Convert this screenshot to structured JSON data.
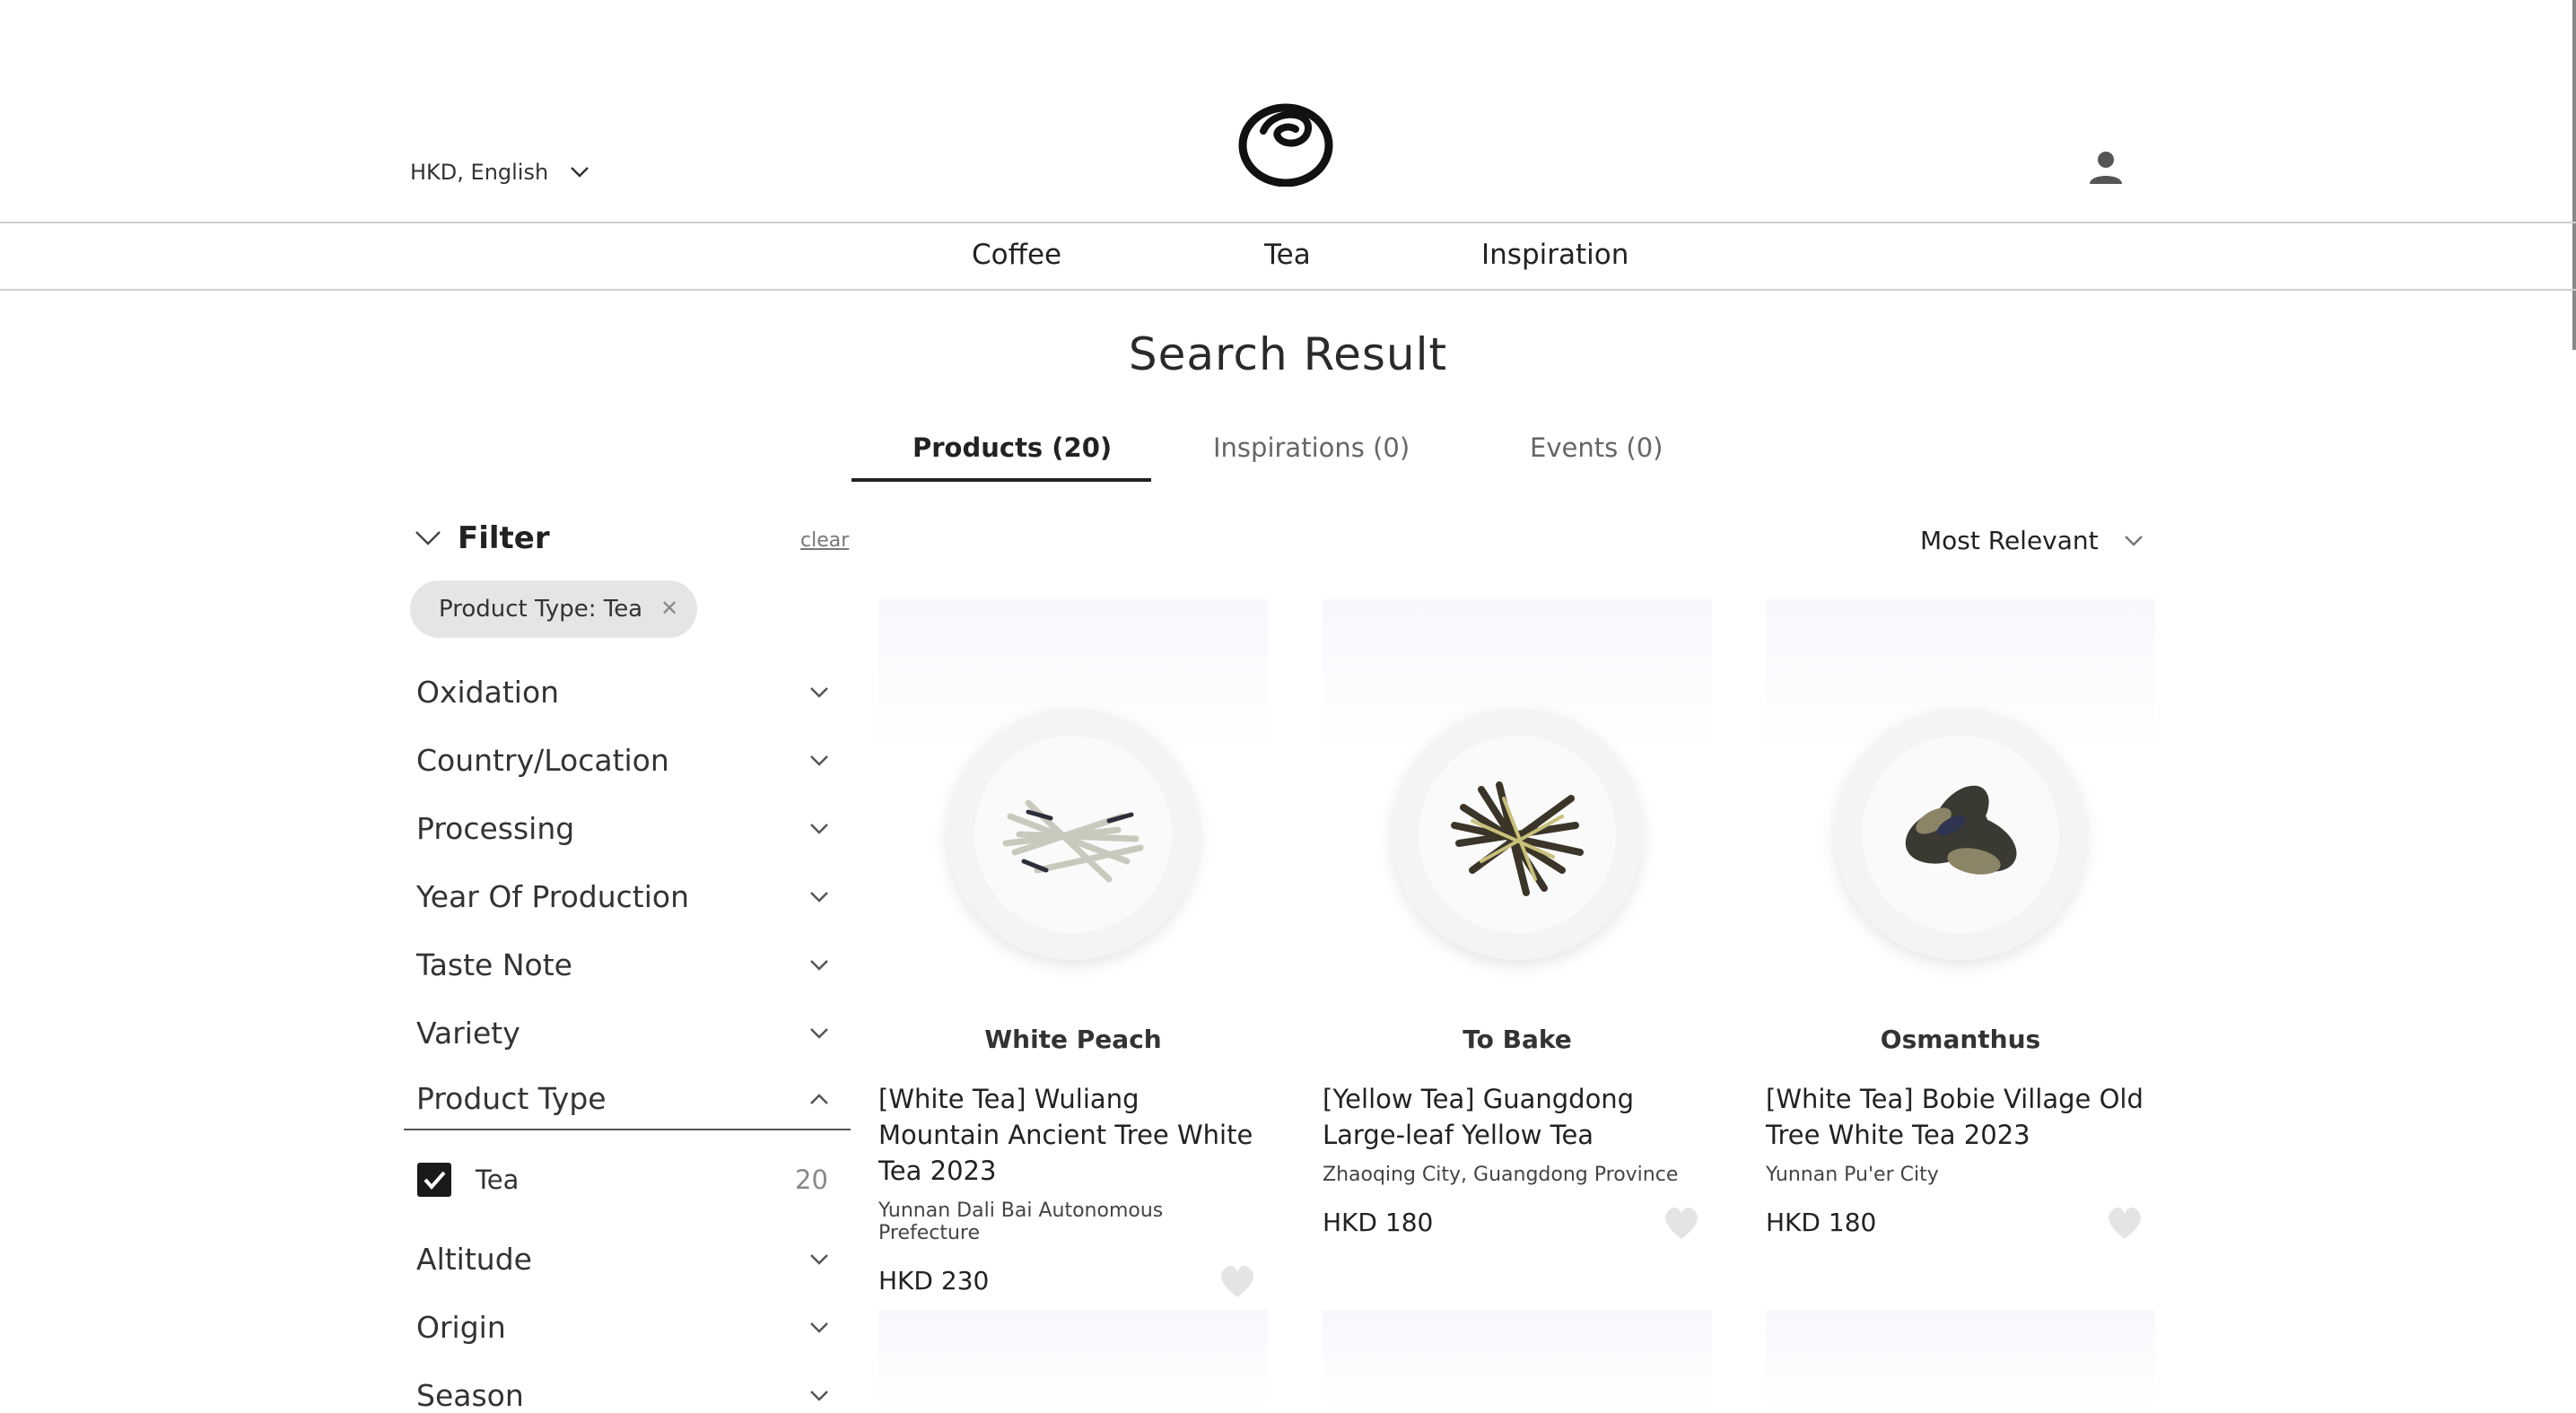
{
  "header": {
    "locale_label": "HKD, English",
    "logo_icon": "brand-logo-icon",
    "user_icon": "user-icon"
  },
  "nav": {
    "items": [
      {
        "label": "Coffee"
      },
      {
        "label": "Tea"
      },
      {
        "label": "Inspiration"
      }
    ]
  },
  "main": {
    "title": "Search Result",
    "tabs": [
      {
        "label": "Products (20)",
        "active": true
      },
      {
        "label": "Inspirations (0)",
        "active": false
      },
      {
        "label": "Events (0)",
        "active": false
      }
    ]
  },
  "filter": {
    "heading": "Filter",
    "clear_label": "clear",
    "chip": "Product Type: Tea",
    "facets": [
      {
        "label": "Oxidation"
      },
      {
        "label": "Country/Location"
      },
      {
        "label": "Processing"
      },
      {
        "label": "Year Of Production"
      },
      {
        "label": "Taste Note"
      },
      {
        "label": "Variety"
      },
      {
        "label": "Product Type",
        "expanded": true
      },
      {
        "label": "Altitude"
      },
      {
        "label": "Origin"
      },
      {
        "label": "Season"
      }
    ],
    "product_type_option": {
      "label": "Tea",
      "count": "20",
      "checked": true
    }
  },
  "sort": {
    "label": "Most Relevant"
  },
  "products": [
    {
      "taste_note": "White Peach",
      "name": "[White Tea] Wuliang Mountain Ancient Tree White Tea 2023",
      "origin": "Yunnan Dali Bai Autonomous Prefecture",
      "price": "HKD 230"
    },
    {
      "taste_note": "To Bake",
      "name": "[Yellow Tea] Guangdong Large-leaf Yellow Tea",
      "origin": "Zhaoqing City, Guangdong Province",
      "price": "HKD 180"
    },
    {
      "taste_note": "Osmanthus",
      "name": "[White Tea] Bobie Village Old Tree White Tea 2023",
      "origin": "Yunnan Pu'er City",
      "price": "HKD 180"
    }
  ],
  "colors": {
    "accent": "#222222",
    "chip_bg": "#e5e5e5",
    "divider": "#cfcfcf"
  }
}
